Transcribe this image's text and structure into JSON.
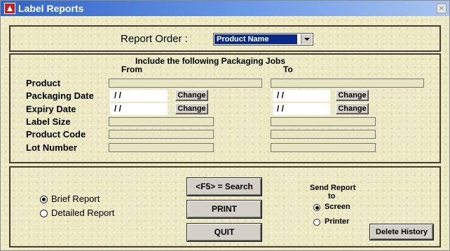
{
  "window": {
    "title": "Label Reports",
    "close_glyph": "×",
    "app_icon": "app-logo-icon"
  },
  "order": {
    "label": "Report Order :",
    "selected": "Product Name"
  },
  "criteria": {
    "heading": "Include the following Packaging Jobs",
    "from_label": "From",
    "to_label": "To",
    "rows": {
      "product": "Product",
      "packaging_date": "Packaging Date",
      "expiry_date": "Expiry Date",
      "label_size": "Label Size",
      "product_code": "Product Code",
      "lot_number": "Lot Number"
    },
    "packaging_from": "/ /",
    "packaging_to": "/ /",
    "expiry_from": "/ /",
    "expiry_to": "/ /",
    "change_label": "Change"
  },
  "report_type": {
    "brief": "Brief Report",
    "detailed": "Detailed Report",
    "selected": "brief"
  },
  "actions": {
    "search": "<F5> = Search",
    "print": "PRINT",
    "quit": "QUIT",
    "delete_history": "Delete History"
  },
  "send": {
    "heading_line1": "Send Report",
    "heading_line2": "to",
    "screen": "Screen",
    "printer": "Printer",
    "selected": "screen"
  }
}
